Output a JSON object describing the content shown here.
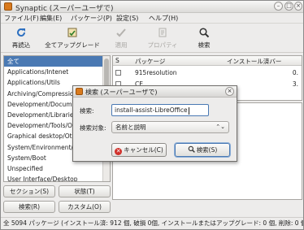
{
  "window": {
    "title": "Synaptic (スーパーユーザで)"
  },
  "menu": [
    "ファイル(F)",
    "編集(E)",
    "パッケージ(P)",
    "設定(S)",
    "ヘルプ(H)"
  ],
  "toolbar": {
    "reload": "再読込",
    "upgrade_all": "全てアップグレード",
    "apply": "適用",
    "properties": "プロパティ",
    "search": "検索"
  },
  "sidebar": {
    "items": [
      "全て",
      "Applications/Intenet",
      "Applications/Utils",
      "Archiving/Compression",
      "Development/Document",
      "Development/Libraries/",
      "Development/Tools/Oth",
      "Graphical desktop/Othe",
      "System/Environment/Da",
      "System/Boot",
      "Unspecified",
      "User Interface/Desktop"
    ]
  },
  "left_buttons": {
    "sections": "セクション(S)",
    "status": "状態(T)",
    "search": "検索(R)",
    "custom": "カスタム(O)"
  },
  "package_table": {
    "headers": [
      "S",
      "パッケージ",
      "インストール済バー"
    ],
    "rows": [
      {
        "name": "915resolution",
        "version": "0."
      },
      {
        "name": "CE",
        "version": "3."
      }
    ]
  },
  "status": "全 5094 パッケージ (インストール済: 912 個, 破損 0個, インストールまたはアップグレード: 0 個, 削除: 0 個",
  "dialog": {
    "title": "検索 (スーパーユーザで)",
    "search_label": "検索:",
    "search_value": "install-assist-LibreOffice",
    "target_label": "検索対象:",
    "target_value": "名前と説明",
    "cancel": "キャンセル(C)",
    "search": "検索(S)"
  },
  "colors": {
    "selection": "#4a79b3",
    "cancel_icon": "#d0302a",
    "app_icon": "#d97a1d"
  }
}
